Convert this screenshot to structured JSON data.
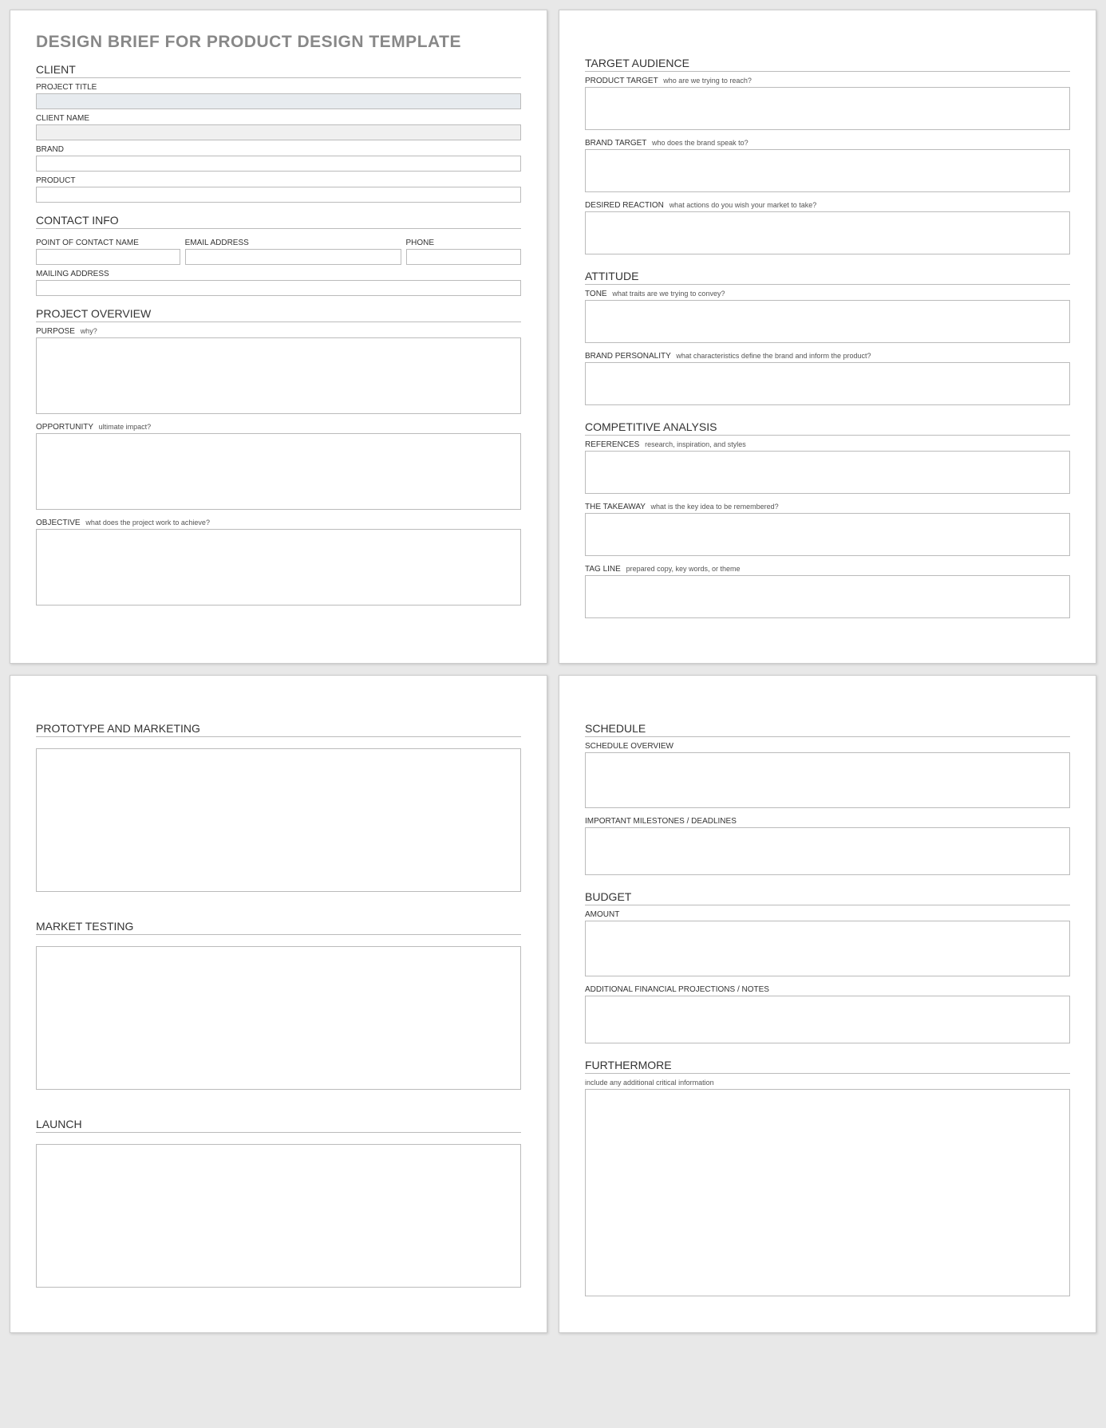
{
  "title": "DESIGN BRIEF FOR PRODUCT DESIGN TEMPLATE",
  "p1": {
    "client": {
      "header": "CLIENT",
      "project_title": "PROJECT TITLE",
      "client_name": "CLIENT NAME",
      "brand": "BRAND",
      "product": "PRODUCT"
    },
    "contact": {
      "header": "CONTACT INFO",
      "poc": "POINT OF CONTACT NAME",
      "email": "EMAIL ADDRESS",
      "phone": "PHONE",
      "mailing": "MAILING ADDRESS"
    },
    "overview": {
      "header": "PROJECT OVERVIEW",
      "purpose_label": "PURPOSE",
      "purpose_hint": "why?",
      "opportunity_label": "OPPORTUNITY",
      "opportunity_hint": "ultimate impact?",
      "objective_label": "OBJECTIVE",
      "objective_hint": "what does the project work to achieve?"
    }
  },
  "p2": {
    "target": {
      "header": "TARGET AUDIENCE",
      "product_target_label": "PRODUCT TARGET",
      "product_target_hint": "who are we trying to reach?",
      "brand_target_label": "BRAND TARGET",
      "brand_target_hint": "who does the brand speak to?",
      "reaction_label": "DESIRED REACTION",
      "reaction_hint": "what actions do you wish your market to take?"
    },
    "attitude": {
      "header": "ATTITUDE",
      "tone_label": "TONE",
      "tone_hint": "what traits are we trying to convey?",
      "personality_label": "BRAND PERSONALITY",
      "personality_hint": "what characteristics define the brand and inform the product?"
    },
    "competitive": {
      "header": "COMPETITIVE ANALYSIS",
      "references_label": "REFERENCES",
      "references_hint": "research, inspiration, and styles",
      "takeaway_label": "THE TAKEAWAY",
      "takeaway_hint": "what is the key idea to be remembered?",
      "tagline_label": "TAG LINE",
      "tagline_hint": "prepared copy, key words, or theme"
    }
  },
  "p3": {
    "prototype": {
      "header": "PROTOTYPE AND MARKETING"
    },
    "market": {
      "header": "MARKET TESTING"
    },
    "launch": {
      "header": "LAUNCH"
    }
  },
  "p4": {
    "schedule": {
      "header": "SCHEDULE",
      "overview": "SCHEDULE OVERVIEW",
      "milestones": "IMPORTANT MILESTONES / DEADLINES"
    },
    "budget": {
      "header": "BUDGET",
      "amount": "AMOUNT",
      "notes": "ADDITIONAL FINANCIAL PROJECTIONS / NOTES"
    },
    "furthermore": {
      "header": "FURTHERMORE",
      "hint": "include any additional critical information"
    }
  }
}
